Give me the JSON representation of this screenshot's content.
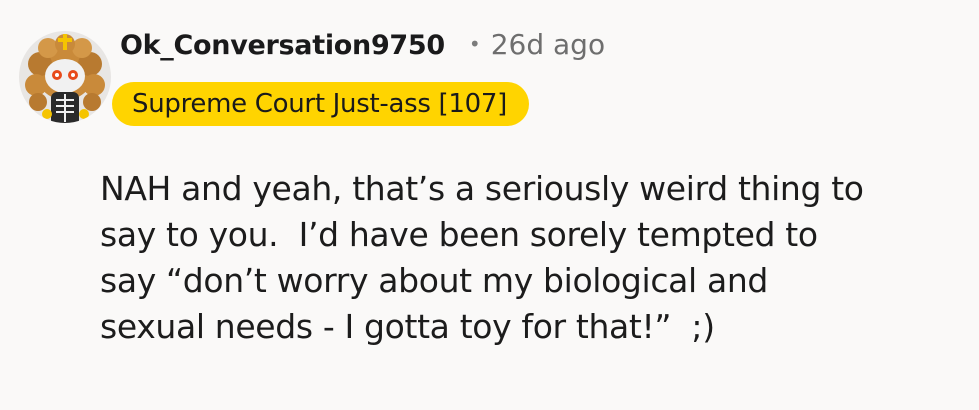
{
  "comment": {
    "username": "Ok_Conversation9750",
    "separator": "•",
    "timestamp": "26d ago",
    "flair": "Supreme Court Just-ass [107]",
    "avatar_icon": "snoo-avatar-icon",
    "body_lines": [
      "NAH and yeah, that’s a seriously weird thing to",
      "say to you.  I’d have been sorely tempted to",
      "say “don’t worry about my biological and",
      "sexual needs - I gotta toy for that!”  ;)"
    ]
  },
  "colors": {
    "background": "#faf9f8",
    "flair_background": "#ffd400",
    "username": "#1a1a1b",
    "timestamp": "#6e6e6e",
    "body_text": "#1c1c1c"
  }
}
